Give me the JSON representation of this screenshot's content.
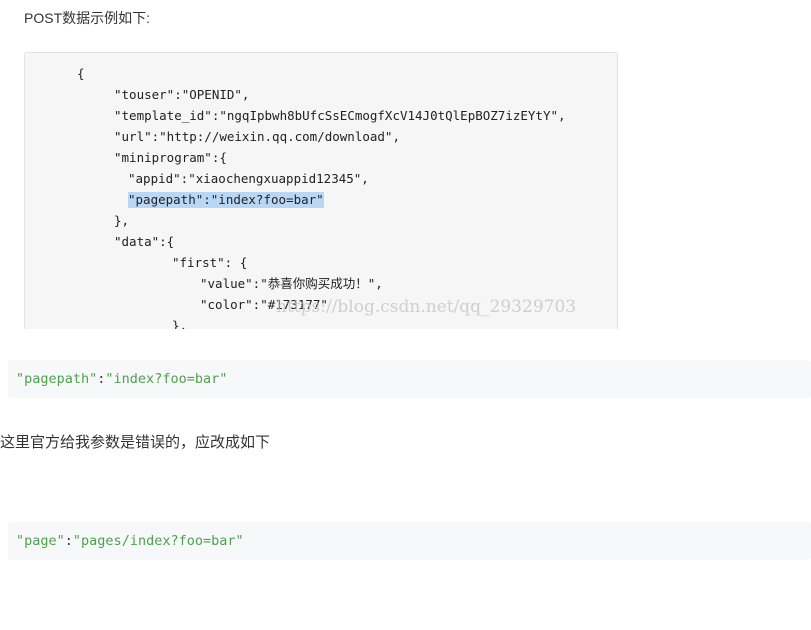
{
  "intro_text": "POST数据示例如下:",
  "screenshot": {
    "code_lines": [
      "{",
      "\"touser\":\"OPENID\",",
      "\"template_id\":\"ngqIpbwh8bUfcSsECmogfXcV14J0tQlEpBOZ7izEYtY\",",
      "\"url\":\"http://weixin.qq.com/download\",",
      "\"miniprogram\":{",
      "\"appid\":\"xiaochengxuappid12345\",",
      "\"pagepath\":\"index?foo=bar\"",
      "},",
      "\"data\":{",
      "\"first\": {",
      "\"value\":\"恭喜你购买成功！\",",
      "\"color\":\"#173177\"",
      "},"
    ],
    "watermark": "https://blog.csdn.net/qq_29329703"
  },
  "snippet_wrong": {
    "key": "\"pagepath\"",
    "sep": ":",
    "value": "\"index?foo=bar\""
  },
  "note_text": "这里官方给我参数是错误的，应改成如下",
  "snippet_fixed": {
    "key": "\"page\"",
    "sep": ":",
    "value": "\"pages/index?foo=bar\""
  },
  "colors": {
    "string_green": "#50a14f",
    "highlight_blue": "#b9d7f5",
    "code_bg": "#f6f8fa"
  }
}
